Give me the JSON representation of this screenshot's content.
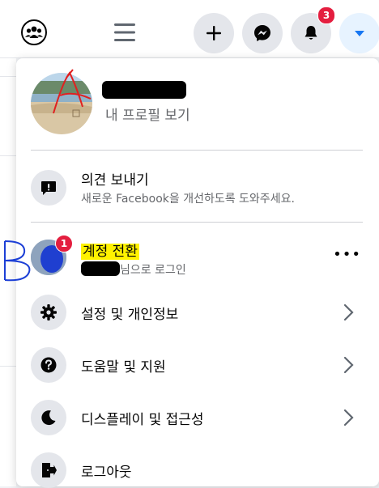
{
  "topbar": {
    "notifications_count": "3",
    "icons": [
      "groups-icon",
      "menu-icon",
      "plus-icon",
      "messenger-icon",
      "bell-icon",
      "caret-down-icon"
    ]
  },
  "menu": {
    "profile": {
      "link_label": "내 프로필 보기"
    },
    "feedback": {
      "title": "의견 보내기",
      "subtitle": "새로운 Facebook을 개선하도록 도와주세요."
    },
    "switch_account": {
      "badge": "1",
      "title": "계정 전환",
      "subtitle": "님으로 로그인",
      "more": "•••"
    },
    "items": [
      {
        "label": "설정 및 개인정보",
        "icon": "gear-icon"
      },
      {
        "label": "도움말 및 지원",
        "icon": "help-icon"
      },
      {
        "label": "디스플레이 및 접근성",
        "icon": "moon-icon"
      },
      {
        "label": "로그아웃",
        "icon": "logout-icon"
      }
    ]
  },
  "annotations": {
    "a": "A",
    "b": "B"
  },
  "colors": {
    "accent": "#1877f2",
    "badge": "#e41e3f",
    "highlight": "#fff200",
    "annotation_red": "#e02020",
    "annotation_blue": "#1c3fd6"
  }
}
